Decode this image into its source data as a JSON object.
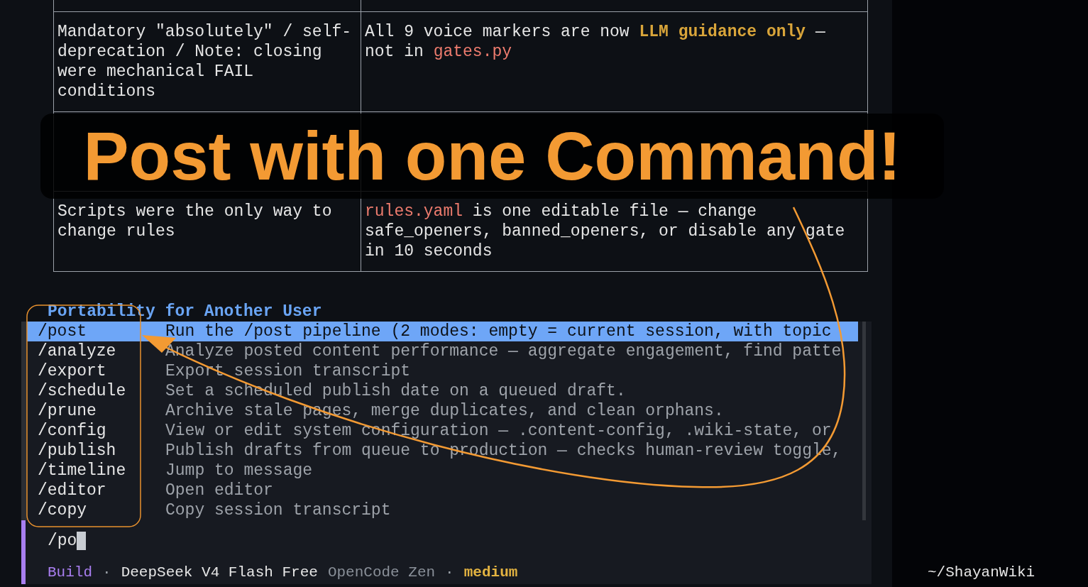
{
  "table": {
    "rows": [
      {
        "cells": [
          [
            {
              "text": "Mandatory \"absolutely\" / self-deprecation / Note: closing were mechanical FAIL conditions",
              "kind": "plain"
            }
          ],
          [
            {
              "text": "All 9 voice markers are now ",
              "kind": "plain"
            },
            {
              "text": "LLM guidance only",
              "kind": "highlight"
            },
            {
              "text": " — not in ",
              "kind": "plain"
            },
            {
              "text": "gates.py",
              "kind": "file"
            }
          ]
        ]
      },
      {
        "cells": [
          [
            {
              "text": "Scripts were the only way to change rules",
              "kind": "plain"
            }
          ],
          [
            {
              "text": "rules.yaml",
              "kind": "file"
            },
            {
              "text": " is one editable file — change safe_openers, banned_openers, or disable any gate in 10 seconds",
              "kind": "plain"
            }
          ]
        ]
      }
    ]
  },
  "annotation": {
    "title": "Post with one Command!"
  },
  "section_title": "Portability for Another User",
  "commands": [
    {
      "name": "/post",
      "description": "Run the /post pipeline (2 modes: empty = current session, with topic",
      "selected": true
    },
    {
      "name": "/analyze",
      "description": "Analyze posted content performance — aggregate engagement, find patte",
      "selected": false
    },
    {
      "name": "/export",
      "description": "Export session transcript",
      "selected": false
    },
    {
      "name": "/schedule",
      "description": "Set a scheduled publish date on a queued draft.",
      "selected": false
    },
    {
      "name": "/prune",
      "description": "Archive stale pages, merge duplicates, and clean orphans.",
      "selected": false
    },
    {
      "name": "/config",
      "description": "View or edit system configuration — .content-config, .wiki-state, or",
      "selected": false
    },
    {
      "name": "/publish",
      "description": "Publish drafts from queue to production — checks human-review toggle,",
      "selected": false
    },
    {
      "name": "/timeline",
      "description": "Jump to message",
      "selected": false
    },
    {
      "name": "/editor",
      "description": "Open editor",
      "selected": false
    },
    {
      "name": "/copy",
      "description": "Copy session transcript",
      "selected": false
    }
  ],
  "input": {
    "value": "/po"
  },
  "status_bar": {
    "items": [
      {
        "text": "Build",
        "kind": "mode"
      },
      {
        "text": "·",
        "kind": "sep"
      },
      {
        "text": "DeepSeek V4 Flash Free",
        "kind": "model"
      },
      {
        "text": "OpenCode Zen",
        "kind": "provider"
      },
      {
        "text": "·",
        "kind": "sep"
      },
      {
        "text": "medium",
        "kind": "variant"
      }
    ],
    "path": "~/ShayanWiki"
  }
}
